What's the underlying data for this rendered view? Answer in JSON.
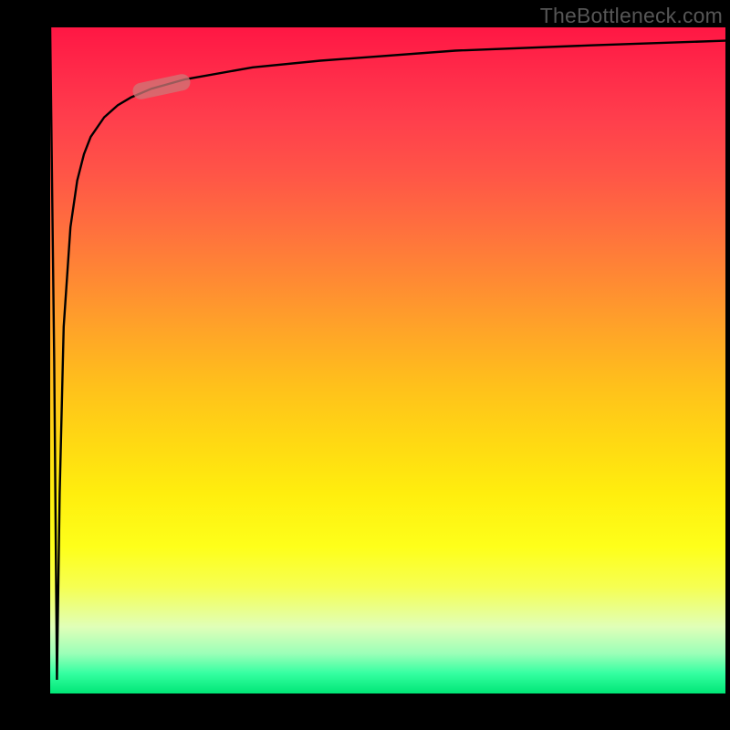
{
  "watermark": "TheBottleneck.com",
  "colors": {
    "frame": "#000000",
    "curve": "#000000",
    "marker": "rgba(205,120,120,0.75)",
    "watermark_text": "#565656"
  },
  "chart_data": {
    "type": "line",
    "title": "",
    "xlabel": "",
    "ylabel": "",
    "xlim": [
      0,
      100
    ],
    "ylim": [
      0,
      100
    ],
    "grid": false,
    "background_gradient": {
      "direction": "top-to-bottom",
      "stops": [
        {
          "pos": 0,
          "color": "#ff1744",
          "meaning": "high bottleneck"
        },
        {
          "pos": 50,
          "color": "#ffc11b",
          "meaning": "medium"
        },
        {
          "pos": 78,
          "color": "#feff1a",
          "meaning": "low-medium"
        },
        {
          "pos": 100,
          "color": "#00e676",
          "meaning": "no bottleneck"
        }
      ]
    },
    "series": [
      {
        "name": "bottleneck-curve",
        "description": "Rises steeply from a deep notch near x≈1 up to ~90 by x≈15, then asymptotically approaches ~98 as x→100.",
        "x": [
          0,
          0.6,
          1.0,
          1.4,
          2,
          3,
          4,
          5,
          6,
          8,
          10,
          12,
          15,
          20,
          30,
          40,
          60,
          80,
          100
        ],
        "y": [
          100,
          50,
          2,
          30,
          55,
          70,
          77,
          81,
          83.5,
          86.5,
          88.3,
          89.5,
          90.8,
          92.2,
          94,
          95,
          96.5,
          97.3,
          98
        ]
      }
    ],
    "marker": {
      "description": "highlighted segment on the curve",
      "approx_x_range": [
        13,
        20
      ],
      "approx_y_range": [
        90,
        92
      ],
      "rotation_degrees": -12
    }
  }
}
